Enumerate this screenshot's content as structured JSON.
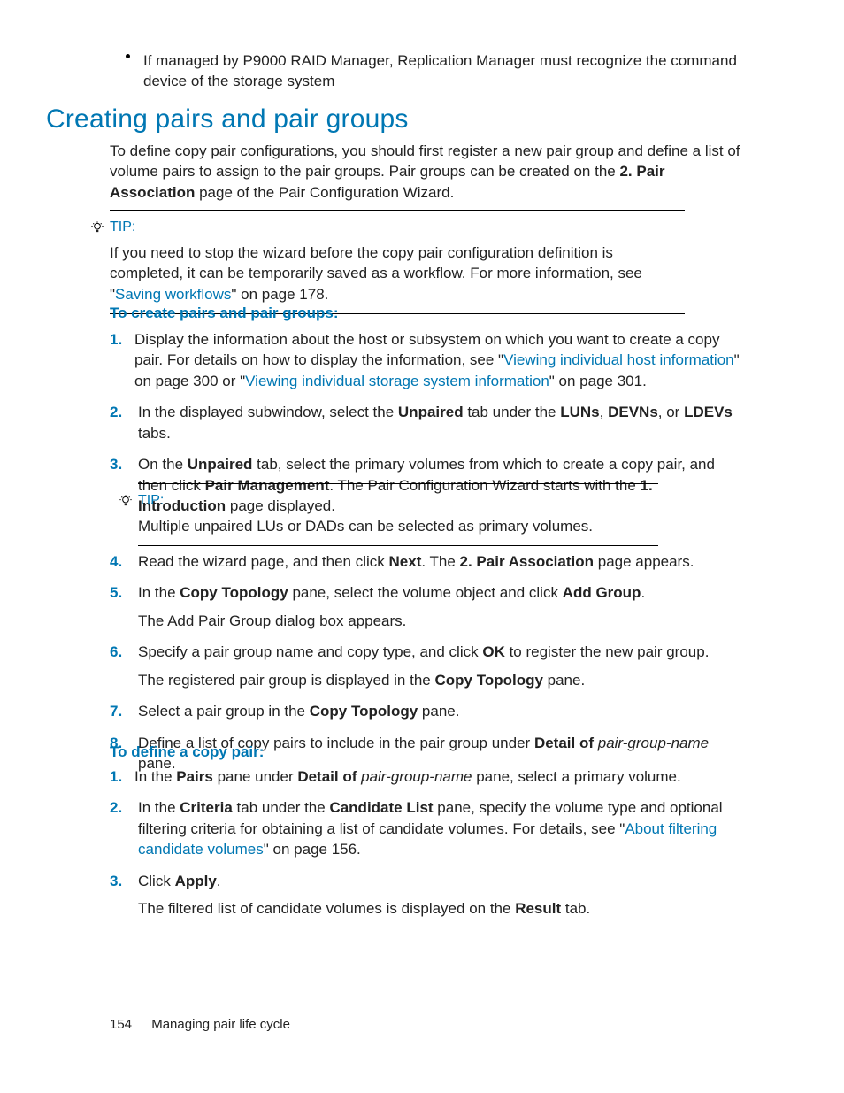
{
  "top_bullet": "If managed by P9000 RAID Manager, Replication Manager must recognize the command device of the storage system",
  "heading": "Creating pairs and pair groups",
  "intro": {
    "t1": "To define copy pair configurations, you should first register a new pair group and define a list of volume pairs to assign to the pair groups. Pair groups can be created on the ",
    "b1": "2. Pair Association",
    "t2": " page of the Pair Configuration Wizard."
  },
  "tip1": {
    "label": "TIP:",
    "t1": "If you need to stop the wizard before the copy pair configuration definition is completed, it can be temporarily saved as a workflow. For more information, see \"",
    "link": "Saving workflows",
    "t2": "\" on page 178."
  },
  "subhead1": "To create pairs and pair groups:",
  "steps1": [
    {
      "n": "1.",
      "t1": "Display the information about the host or subsystem on which you want to create a copy pair. For details on how to display the information, see \"",
      "l1": "Viewing individual host information",
      "t2": "\" on page 300 or \"",
      "l2": "Viewing individual storage system information",
      "t3": "\" on page 301."
    },
    {
      "n": "2.",
      "t1": "In the displayed subwindow, select the ",
      "b1": "Unpaired",
      "t2": " tab under the ",
      "b2": "LUNs",
      "t3": ", ",
      "b3": "DEVNs",
      "t4": ", or ",
      "b4": "LDEVs",
      "t5": " tabs."
    },
    {
      "n": "3.",
      "t1": "On the ",
      "b1": "Unpaired",
      "t2": " tab, select the primary volumes from which to create a copy pair, and then click ",
      "b2": "Pair Management",
      "t3": ". The Pair Configuration Wizard starts with the ",
      "b3": "1. Introduction",
      "t4": " page displayed."
    }
  ],
  "tip2": {
    "label": "TIP:",
    "body": "Multiple unpaired LUs or DADs can be selected as primary volumes."
  },
  "steps1b": [
    {
      "n": "4.",
      "t1": "Read the wizard page, and then click ",
      "b1": "Next",
      "t2": ". The ",
      "b2": "2. Pair Association",
      "t3": " page appears."
    },
    {
      "n": "5.",
      "t1": "In the ",
      "b1": "Copy Topology",
      "t2": " pane, select the volume object and click ",
      "b2": "Add Group",
      "t3": ".",
      "sub": "The Add Pair Group dialog box appears."
    },
    {
      "n": "6.",
      "t1": "Specify a pair group name and copy type, and click ",
      "b1": "OK",
      "t2": " to register the new pair group.",
      "sub_t1": "The registered pair group is displayed in the ",
      "sub_b1": "Copy Topology",
      "sub_t2": " pane."
    },
    {
      "n": "7.",
      "t1": "Select a pair group in the ",
      "b1": "Copy Topology",
      "t2": " pane."
    },
    {
      "n": "8.",
      "t1": "Define a list of copy pairs to include in the pair group under ",
      "b1": "Detail of ",
      "i1": "pair-group-name",
      "t2": " pane."
    }
  ],
  "subhead2": "To define a copy pair:",
  "steps2": [
    {
      "n": "1.",
      "t1": "In the ",
      "b1": "Pairs",
      "t2": " pane under ",
      "b2": "Detail of ",
      "i1": "pair-group-name",
      "t3": " pane, select a primary volume."
    },
    {
      "n": "2.",
      "t1": "In the ",
      "b1": "Criteria",
      "t2": " tab under the ",
      "b2": "Candidate List",
      "t3": " pane, specify the volume type and optional filtering criteria for obtaining a list of candidate volumes. For details, see \"",
      "l1": "About filtering candidate volumes",
      "t4": "\" on page 156."
    },
    {
      "n": "3.",
      "t1": "Click ",
      "b1": "Apply",
      "t2": ".",
      "sub_t1": "The filtered list of candidate volumes is displayed on the ",
      "sub_b1": "Result",
      "sub_t2": " tab."
    }
  ],
  "footer": {
    "page": "154",
    "title": "Managing pair life cycle"
  }
}
